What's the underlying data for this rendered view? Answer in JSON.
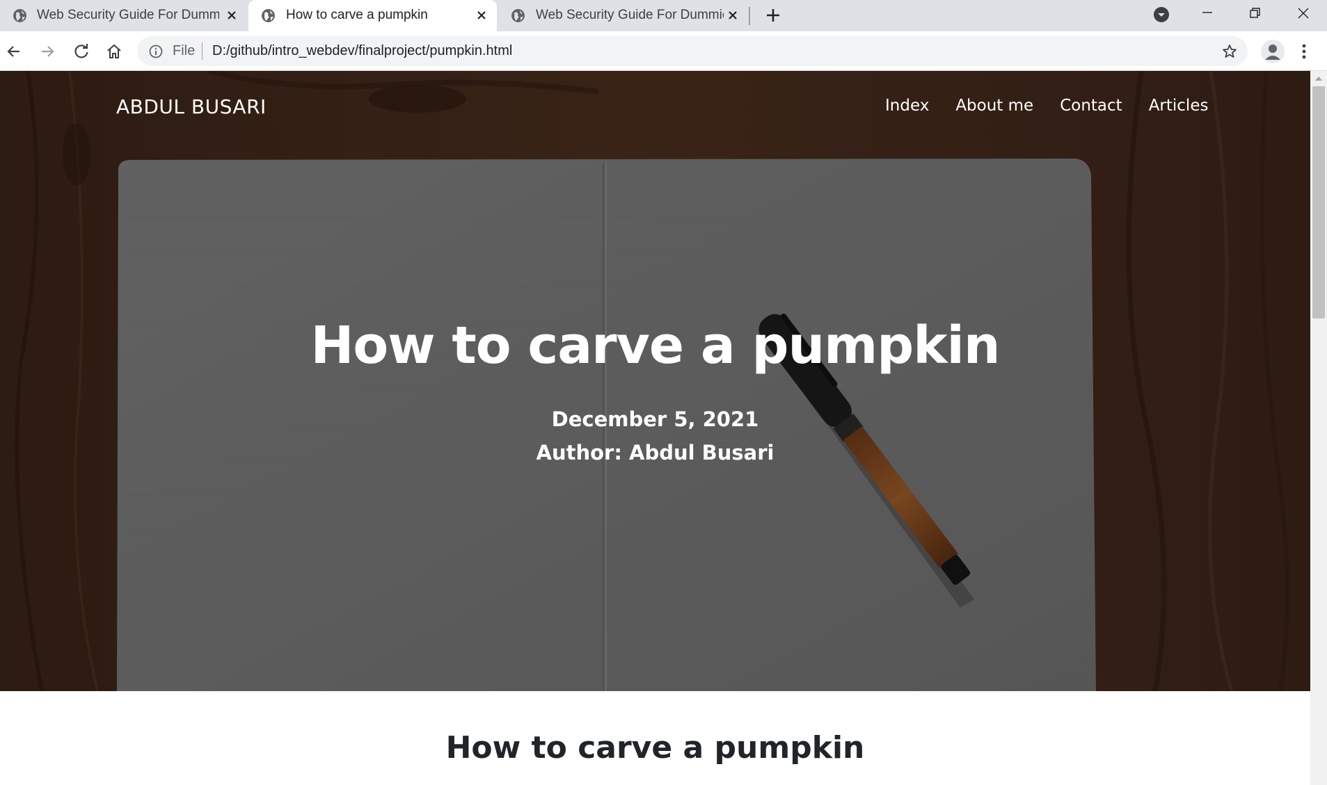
{
  "browser": {
    "tabs": [
      {
        "title": "Web Security Guide For Dummies",
        "active": false,
        "favicon": "globe-icon"
      },
      {
        "title": "How to carve a pumpkin",
        "active": true,
        "favicon": "globe-icon"
      },
      {
        "title": "Web Security Guide For Dummies",
        "active": false,
        "favicon": "globe-icon"
      }
    ],
    "address": {
      "scheme_label": "File",
      "url": "D:/github/intro_webdev/finalproject/pumpkin.html"
    },
    "accent_colors": {
      "tabstrip": "#dee1e6",
      "omnibox": "#f1f3f4"
    }
  },
  "site": {
    "brand": "ABDUL BUSARI",
    "nav": [
      "Index",
      "About me",
      "Contact",
      "Articles"
    ]
  },
  "hero": {
    "title": "How to carve a pumpkin",
    "date": "December 5, 2021",
    "author": "Author: Abdul Busari",
    "background_image": "open notebook with pen on wooden table"
  },
  "content": {
    "heading": "How to carve a pumpkin"
  }
}
